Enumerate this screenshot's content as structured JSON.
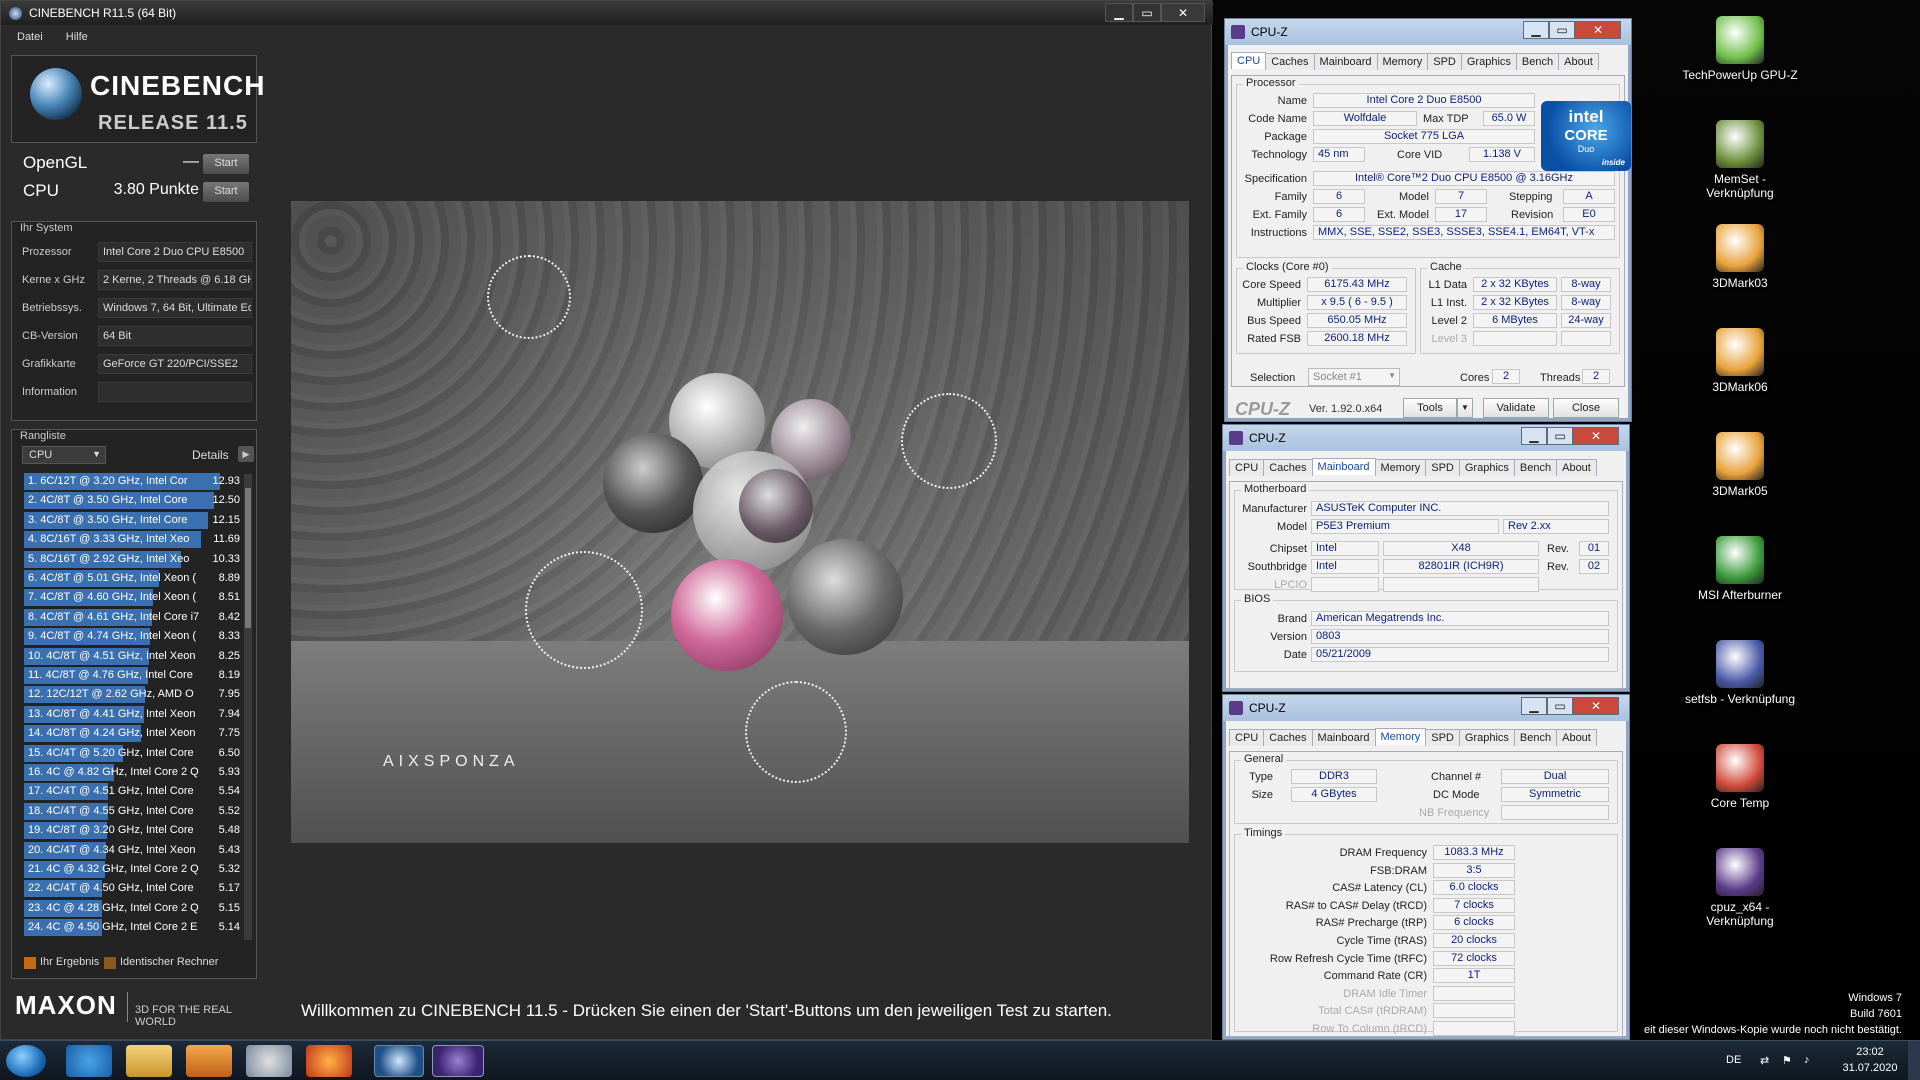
{
  "cinebench": {
    "title": "CINEBENCH R11.5 (64 Bit)",
    "menu": [
      "Datei",
      "Hilfe"
    ],
    "logo_word": "CINEBENCH",
    "logo_release": "RELEASE 11.5",
    "opengl_label": "OpenGL",
    "opengl_value": "—",
    "cpu_label": "CPU",
    "cpu_value": "3.80 Punkte",
    "start_label": "Start",
    "system_header": "Ihr System",
    "system": [
      {
        "key": "Prozessor",
        "value": "Intel Core 2 Duo CPU E8500"
      },
      {
        "key": "Kerne x GHz",
        "value": "2 Kerne, 2 Threads @ 6.18 GH"
      },
      {
        "key": "Betriebssys.",
        "value": "Windows 7, 64 Bit, Ultimate Edi"
      },
      {
        "key": "CB-Version",
        "value": "64 Bit"
      },
      {
        "key": "Grafikkarte",
        "value": "GeForce GT 220/PCI/SSE2"
      },
      {
        "key": "Information",
        "value": ""
      }
    ],
    "ranking_header": "Rangliste",
    "ranking_select": "CPU",
    "details_label": "Details",
    "ranking": [
      {
        "text": "1. 6C/12T @ 3.20 GHz, Intel Cor",
        "score": "12.93",
        "frac": 1.0
      },
      {
        "text": "2. 4C/8T @ 3.50 GHz, Intel Core",
        "score": "12.50",
        "frac": 0.967
      },
      {
        "text": "3. 4C/8T @ 3.50 GHz, Intel Core",
        "score": "12.15",
        "frac": 0.94
      },
      {
        "text": "4. 8C/16T @ 3.33 GHz, Intel Xeo",
        "score": "11.69",
        "frac": 0.904
      },
      {
        "text": "5. 8C/16T @ 2.92 GHz, Intel Xeo",
        "score": "10.33",
        "frac": 0.799
      },
      {
        "text": "6. 4C/8T @ 5.01 GHz, Intel Xeon (",
        "score": "8.89",
        "frac": 0.688
      },
      {
        "text": "7. 4C/8T @ 4.60 GHz, Intel Xeon (",
        "score": "8.51",
        "frac": 0.658
      },
      {
        "text": "8. 4C/8T @ 4.61 GHz, Intel Core i7",
        "score": "8.42",
        "frac": 0.651
      },
      {
        "text": "9. 4C/8T @ 4.74 GHz, Intel Xeon (",
        "score": "8.33",
        "frac": 0.644
      },
      {
        "text": "10. 4C/8T @ 4.51 GHz, Intel Xeon",
        "score": "8.25",
        "frac": 0.638
      },
      {
        "text": "11. 4C/8T @ 4.76 GHz, Intel Core",
        "score": "8.19",
        "frac": 0.633
      },
      {
        "text": "12. 12C/12T @ 2.62 GHz, AMD O",
        "score": "7.95",
        "frac": 0.615
      },
      {
        "text": "13. 4C/8T @ 4.41 GHz, Intel Xeon",
        "score": "7.94",
        "frac": 0.614
      },
      {
        "text": "14. 4C/8T @ 4.24 GHz, Intel Xeon",
        "score": "7.75",
        "frac": 0.599
      },
      {
        "text": "15. 4C/4T @ 5.20 GHz, Intel Core",
        "score": "6.50",
        "frac": 0.503
      },
      {
        "text": "16. 4C @ 4.82 GHz, Intel Core 2 Q",
        "score": "5.93",
        "frac": 0.459
      },
      {
        "text": "17. 4C/4T @ 4.51 GHz, Intel Core",
        "score": "5.54",
        "frac": 0.428
      },
      {
        "text": "18. 4C/4T @ 4.55 GHz, Intel Core",
        "score": "5.52",
        "frac": 0.427
      },
      {
        "text": "19. 4C/8T @ 3.20 GHz, Intel Core",
        "score": "5.48",
        "frac": 0.424
      },
      {
        "text": "20. 4C/4T @ 4.34 GHz, Intel Xeon",
        "score": "5.43",
        "frac": 0.42
      },
      {
        "text": "21. 4C @ 4.32 GHz, Intel Core 2 Q",
        "score": "5.32",
        "frac": 0.411
      },
      {
        "text": "22. 4C/4T @ 4.50 GHz, Intel Core",
        "score": "5.17",
        "frac": 0.4
      },
      {
        "text": "23. 4C @ 4.28 GHz, Intel Core 2 Q",
        "score": "5.15",
        "frac": 0.398
      },
      {
        "text": "24. 4C @ 4.50 GHz, Intel Core 2 E",
        "score": "5.14",
        "frac": 0.398
      }
    ],
    "legend_yours": "Ihr Ergebnis",
    "legend_identical": "Identischer Rechner",
    "maxon": "MAXON",
    "maxon_tag": "3D FOR THE REAL WORLD",
    "render_brand": "AIXSPONZA",
    "status": "Willkommen zu CINEBENCH 11.5 - Drücken Sie einen der 'Start'-Buttons um den jeweiligen Test zu starten."
  },
  "cpuz_cpu": {
    "title": "CPU-Z",
    "tabs": [
      "CPU",
      "Caches",
      "Mainboard",
      "Memory",
      "SPD",
      "Graphics",
      "Bench",
      "About"
    ],
    "active_tab": "CPU",
    "processor_group": "Processor",
    "name_label": "Name",
    "name": "Intel Core 2 Duo E8500",
    "codename_label": "Code Name",
    "codename": "Wolfdale",
    "maxtdp_label": "Max TDP",
    "maxtdp": "65.0 W",
    "package_label": "Package",
    "package": "Socket 775 LGA",
    "technology_label": "Technology",
    "technology": "45 nm",
    "corevid_label": "Core VID",
    "corevid": "1.138 V",
    "spec_label": "Specification",
    "spec": "Intel® Core™2 Duo CPU     E8500  @ 3.16GHz",
    "family_label": "Family",
    "family": "6",
    "model_label": "Model",
    "model": "7",
    "stepping_label": "Stepping",
    "stepping": "A",
    "extfamily_label": "Ext. Family",
    "extfamily": "6",
    "extmodel_label": "Ext. Model",
    "extmodel": "17",
    "revision_label": "Revision",
    "revision": "E0",
    "instructions_label": "Instructions",
    "instructions": "MMX, SSE, SSE2, SSE3, SSSE3, SSE4.1, EM64T, VT-x",
    "intel_word": "intel",
    "intel_core": "CORE",
    "intel_duo": "Duo",
    "intel_inside": "inside",
    "clocks_group": "Clocks (Core #0)",
    "corespeed_label": "Core Speed",
    "corespeed": "6175.43 MHz",
    "multiplier_label": "Multiplier",
    "multiplier": "x 9.5 ( 6 - 9.5 )",
    "busspeed_label": "Bus Speed",
    "busspeed": "650.05 MHz",
    "ratedfsb_label": "Rated FSB",
    "ratedfsb": "2600.18 MHz",
    "cache_group": "Cache",
    "l1d_label": "L1 Data",
    "l1d": "2 x 32 KBytes",
    "l1d_way": "8-way",
    "l1i_label": "L1 Inst.",
    "l1i": "2 x 32 KBytes",
    "l1i_way": "8-way",
    "l2_label": "Level 2",
    "l2": "6 MBytes",
    "l2_way": "24-way",
    "l3_label": "Level 3",
    "selection_label": "Selection",
    "selection": "Socket #1",
    "cores_label": "Cores",
    "cores": "2",
    "threads_label": "Threads",
    "threads": "2",
    "logo": "CPU-Z",
    "version": "Ver. 1.92.0.x64",
    "tools": "Tools",
    "validate": "Validate",
    "close": "Close"
  },
  "cpuz_mb": {
    "title": "CPU-Z",
    "tabs": [
      "CPU",
      "Caches",
      "Mainboard",
      "Memory",
      "SPD",
      "Graphics",
      "Bench",
      "About"
    ],
    "active_tab": "Mainboard",
    "motherboard_group": "Motherboard",
    "manufacturer_label": "Manufacturer",
    "manufacturer": "ASUSTeK Computer INC.",
    "model_label": "Model",
    "model": "P5E3 Premium",
    "model_rev": "Rev 2.xx",
    "chipset_label": "Chipset",
    "chipset_vendor": "Intel",
    "chipset": "X48",
    "chipset_rev_label": "Rev.",
    "chipset_rev": "01",
    "southbridge_label": "Southbridge",
    "sb_vendor": "Intel",
    "southbridge": "82801IR (ICH9R)",
    "sb_rev_label": "Rev.",
    "sb_rev": "02",
    "lpcio_label": "LPCIO",
    "bios_group": "BIOS",
    "brand_label": "Brand",
    "brand": "American Megatrends Inc.",
    "version_label": "Version",
    "version": "0803",
    "date_label": "Date",
    "date": "05/21/2009"
  },
  "cpuz_mem": {
    "title": "CPU-Z",
    "tabs": [
      "CPU",
      "Caches",
      "Mainboard",
      "Memory",
      "SPD",
      "Graphics",
      "Bench",
      "About"
    ],
    "active_tab": "Memory",
    "general_group": "General",
    "type_label": "Type",
    "type": "DDR3",
    "channel_label": "Channel #",
    "channel": "Dual",
    "size_label": "Size",
    "size": "4 GBytes",
    "dcmode_label": "DC Mode",
    "dcmode": "Symmetric",
    "nbfreq_label": "NB Frequency",
    "timings_group": "Timings",
    "timings": [
      {
        "label": "DRAM Frequency",
        "value": "1083.3 MHz"
      },
      {
        "label": "FSB:DRAM",
        "value": "3:5"
      },
      {
        "label": "CAS# Latency (CL)",
        "value": "6.0 clocks"
      },
      {
        "label": "RAS# to CAS# Delay (tRCD)",
        "value": "7 clocks"
      },
      {
        "label": "RAS# Precharge (tRP)",
        "value": "6 clocks"
      },
      {
        "label": "Cycle Time (tRAS)",
        "value": "20 clocks"
      },
      {
        "label": "Row Refresh Cycle Time (tRFC)",
        "value": "72 clocks"
      },
      {
        "label": "Command Rate (CR)",
        "value": "1T"
      },
      {
        "label": "DRAM Idle Timer",
        "value": ""
      },
      {
        "label": "Total CAS# (tRDRAM)",
        "value": ""
      },
      {
        "label": "Row To Column (tRCD)",
        "value": ""
      }
    ]
  },
  "desktop_icons": [
    {
      "label": "TechPowerUp GPU-Z",
      "icon": "gpu-z-icon"
    },
    {
      "label": "MemSet - Verknüpfung",
      "icon": "memset-icon"
    },
    {
      "label": "3DMark03",
      "icon": "3dmark-icon"
    },
    {
      "label": "3DMark06",
      "icon": "3dmark-icon"
    },
    {
      "label": "3DMark05",
      "icon": "3dmark-icon"
    },
    {
      "label": "MSI Afterburner",
      "icon": "afterburner-icon"
    },
    {
      "label": "setfsb - Verknüpfung",
      "icon": "setfsb-icon"
    },
    {
      "label": "Core Temp",
      "icon": "thermometer-icon"
    },
    {
      "label": "cpuz_x64 - Verknüpfung",
      "icon": "cpuz-icon"
    }
  ],
  "windows_notice": {
    "line1": "Windows 7",
    "line2": "Build 7601",
    "line3": "eit dieser Windows-Kopie wurde noch nicht bestätigt."
  },
  "taskbar": {
    "language": "DE",
    "time": "23:02",
    "date": "31.07.2020"
  }
}
